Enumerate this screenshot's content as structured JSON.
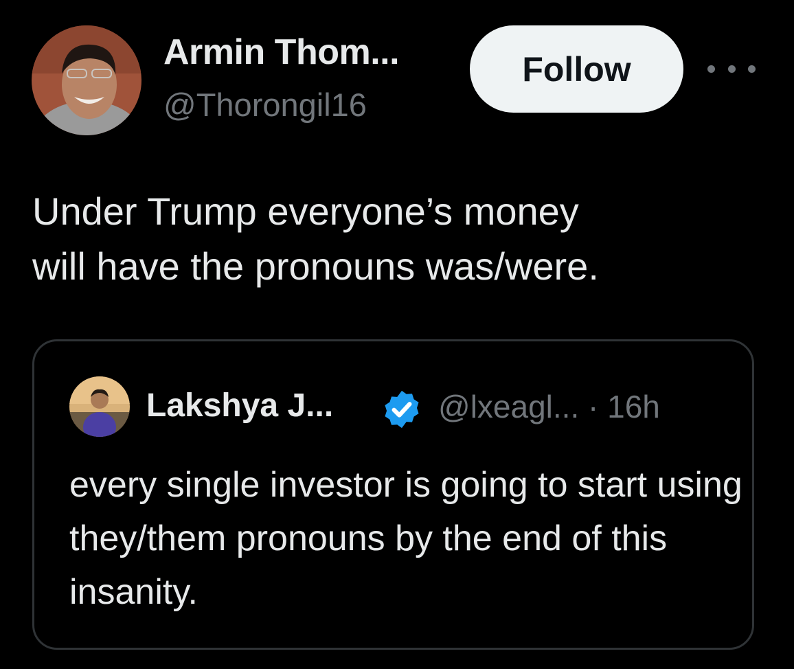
{
  "tweet": {
    "author": {
      "display_name": "Armin Thom...",
      "handle": "@Thorongil16"
    },
    "follow_label": "Follow",
    "text": "Under Trump everyone’s money\nwill have the pronouns was/were."
  },
  "quoted_tweet": {
    "author": {
      "display_name": "Lakshya J...",
      "handle": "@lxeagl...",
      "verified": true
    },
    "meta": "· 16h",
    "text": "every single investor is going to start using they/them pronouns by the end of this insanity."
  },
  "icons": {
    "more": "ellipsis-icon",
    "verified": "verified-badge-icon"
  },
  "colors": {
    "background": "#000000",
    "text_primary": "#e7e9ea",
    "text_secondary": "#71767b",
    "follow_bg": "#eff3f4",
    "verified_blue": "#1d9bf0",
    "border": "#2f3336"
  }
}
